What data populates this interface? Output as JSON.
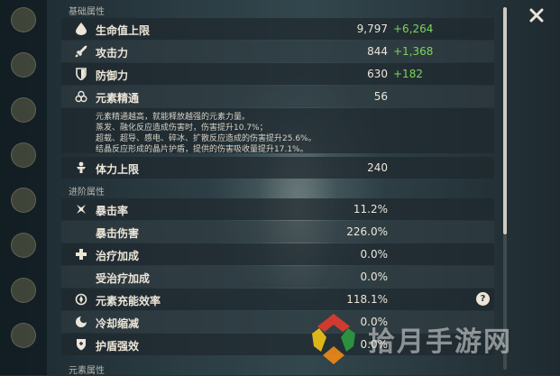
{
  "sections": {
    "base": "基础属性",
    "advanced": "进阶属性",
    "elemental": "元素属性"
  },
  "base_stats": [
    {
      "icon": "hp-drop-icon",
      "label": "生命值上限",
      "value": "9,797",
      "bonus": "+6,264"
    },
    {
      "icon": "sword-icon",
      "label": "攻击力",
      "value": "844",
      "bonus": "+1,368"
    },
    {
      "icon": "shield-icon",
      "label": "防御力",
      "value": "630",
      "bonus": "+182"
    },
    {
      "icon": "elemental-mastery-icon",
      "label": "元素精通",
      "value": "56",
      "bonus": ""
    },
    {
      "icon": "stamina-icon",
      "label": "体力上限",
      "value": "240",
      "bonus": ""
    }
  ],
  "em_description": [
    "元素精通越高，就能释放越强的元素力量。",
    "蒸发、融化反应造成伤害时，伤害提升10.7%；",
    "超载、超导、感电、碎冰、扩散反应造成的伤害提升25.6%。",
    "结晶反应形成的晶片护盾，提供的伤害吸收量提升17.1%。"
  ],
  "advanced_stats": [
    {
      "icon": "crit-rate-icon",
      "label": "暴击率",
      "value": "11.2%"
    },
    {
      "icon": "",
      "label": "暴击伤害",
      "value": "226.0%"
    },
    {
      "icon": "healing-cross-icon",
      "label": "治疗加成",
      "value": "0.0%"
    },
    {
      "icon": "",
      "label": "受治疗加成",
      "value": "0.0%"
    },
    {
      "icon": "energy-recharge-icon",
      "label": "元素充能效率",
      "value": "118.1%"
    },
    {
      "icon": "cd-reduction-icon",
      "label": "冷却缩减",
      "value": "0.0%"
    },
    {
      "icon": "shield-strength-icon",
      "label": "护盾强效",
      "value": "0.0%"
    }
  ],
  "help_symbol": "?",
  "watermark": "拾月手游网",
  "colors": {
    "bonus_green": "#7ed35d",
    "text": "#ece5d8",
    "row_bg": "#1e282e"
  }
}
